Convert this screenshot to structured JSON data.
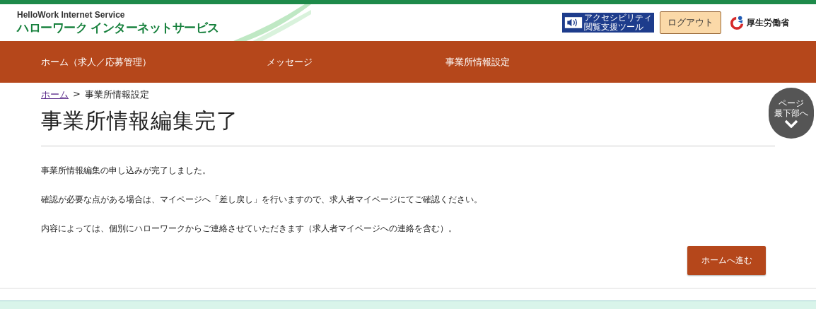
{
  "header": {
    "logo_en": "HelloWork Internet Service",
    "logo_ja": "ハローワーク インターネットサービス",
    "accessibility_tool": [
      "アクセシビリティ",
      "閲覧支援ツール"
    ],
    "logout_button": "ログアウト",
    "ministry": "厚生労働省"
  },
  "nav": [
    {
      "label": "ホーム（求人／応募管理）"
    },
    {
      "label": "メッセージ"
    },
    {
      "label": "事業所情報設定"
    }
  ],
  "breadcrumb": {
    "link": "ホーム",
    "separator": ">",
    "current": "事業所情報設定"
  },
  "page_title": "事業所情報編集完了",
  "messages": [
    "事業所情報編集の申し込みが完了しました。",
    "確認が必要な点がある場合は、マイページへ「差し戻し」を行いますので、求人者マイページにてご確認ください。",
    "内容によっては、個別にハローワークからご連絡させていただきます（求人者マイページへの連絡を含む）。"
  ],
  "scroll_button": [
    "ページ",
    "最下部へ"
  ],
  "home_button": "ホームへ進む"
}
